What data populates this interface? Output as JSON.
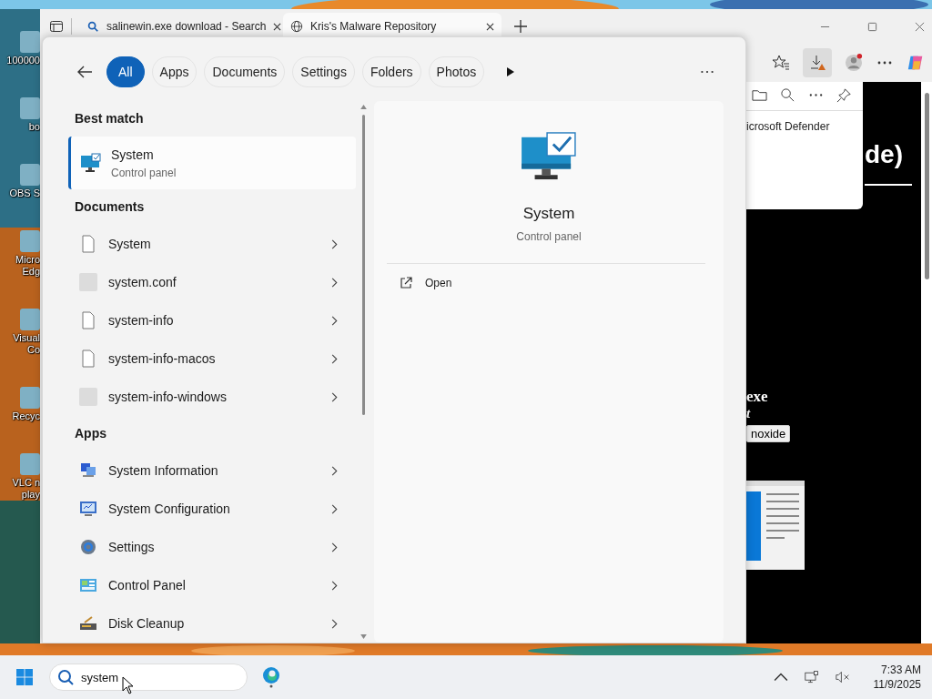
{
  "desktop_icons": [
    {
      "lines": [
        "100000"
      ]
    },
    {
      "lines": [
        "bo"
      ]
    },
    {
      "lines": [
        "OBS S"
      ]
    },
    {
      "lines": [
        "Micro",
        "Edg"
      ]
    },
    {
      "lines": [
        "Visual",
        "Co"
      ]
    },
    {
      "lines": [
        "Recyc"
      ]
    },
    {
      "lines": [
        "VLC n",
        "play"
      ]
    }
  ],
  "browser": {
    "tabs": [
      {
        "title": "salinewin.exe download - Search",
        "kind": "search",
        "selected": false
      },
      {
        "title": "Kris's Malware Repository",
        "kind": "web",
        "selected": true
      }
    ],
    "downloads_flyout": {
      "text": "icrosoft Defender"
    },
    "page": {
      "heading": "de)",
      "subheading": "exe",
      "italic_text": "t",
      "button": "noxide"
    }
  },
  "search_panel": {
    "filters": [
      {
        "label": "All",
        "selected": true
      },
      {
        "label": "Apps",
        "selected": false
      },
      {
        "label": "Documents",
        "selected": false
      },
      {
        "label": "Settings",
        "selected": false
      },
      {
        "label": "Folders",
        "selected": false
      },
      {
        "label": "Photos",
        "selected": false
      }
    ],
    "best_match_title": "Best match",
    "best_match": {
      "title": "System",
      "subtitle": "Control panel",
      "selected": true
    },
    "sections": [
      {
        "title": "Documents",
        "items": [
          {
            "name": "System",
            "kind": "file"
          },
          {
            "name": "system.conf",
            "kind": "blank"
          },
          {
            "name": "system-info",
            "kind": "file"
          },
          {
            "name": "system-info-macos",
            "kind": "file"
          },
          {
            "name": "system-info-windows",
            "kind": "blank"
          }
        ]
      },
      {
        "title": "Apps",
        "items": [
          {
            "name": "System Information",
            "kind": "sysinfo"
          },
          {
            "name": "System Configuration",
            "kind": "sysconfig"
          },
          {
            "name": "Settings",
            "kind": "settings"
          },
          {
            "name": "Control Panel",
            "kind": "controlpanel"
          },
          {
            "name": "Disk Cleanup",
            "kind": "diskcleanup"
          }
        ]
      }
    ],
    "preview": {
      "title": "System",
      "subtitle": "Control panel",
      "actions": [
        "Open"
      ]
    }
  },
  "taskbar": {
    "search_value": "system",
    "time": "7:33 AM",
    "date": "11/9/2025"
  }
}
